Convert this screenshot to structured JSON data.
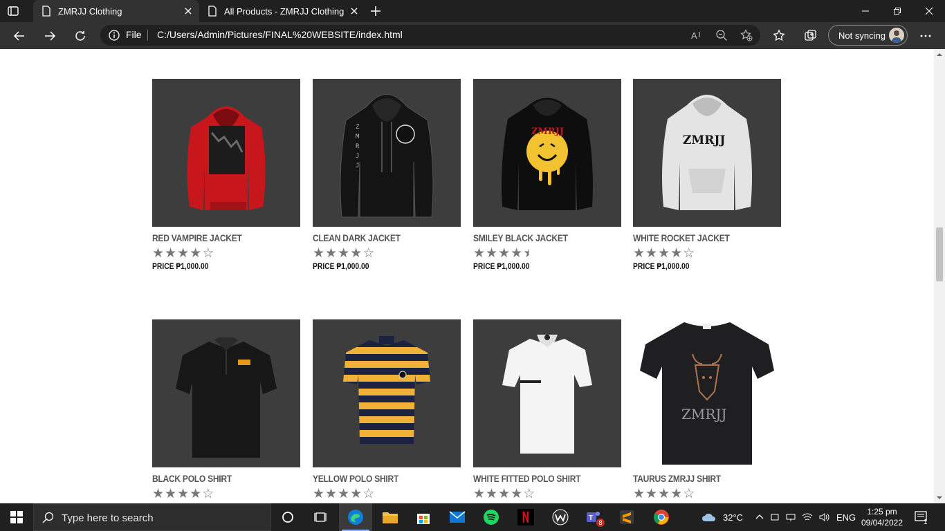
{
  "browser": {
    "tabs": [
      {
        "title": "ZMRJJ Clothing",
        "active": true
      },
      {
        "title": "All Products - ZMRJJ Clothing",
        "active": false
      }
    ],
    "address": {
      "scheme_label": "File",
      "url": "C:/Users/Admin/Pictures/FINAL%20WEBSITE/index.html"
    },
    "sync_label": "Not syncing"
  },
  "products": [
    {
      "name": "RED VAMPIRE JACKET",
      "price": "PRICE ₱1,000.00",
      "rating": 4,
      "image": "red-hoodie"
    },
    {
      "name": "CLEAN DARK JACKET",
      "price": "PRICE ₱1,000.00",
      "rating": 4,
      "image": "black-hoodie"
    },
    {
      "name": "SMILEY BLACK JACKET",
      "price": "PRICE ₱1,000.00",
      "rating": 4.5,
      "image": "smiley-hoodie"
    },
    {
      "name": "WHITE ROCKET JACKET",
      "price": "PRICE ₱1,000.00",
      "rating": 4,
      "image": "white-hoodie"
    },
    {
      "name": "BLACK POLO SHIRT",
      "price": "",
      "rating": 4,
      "image": "black-polo"
    },
    {
      "name": "YELLOW POLO SHIRT",
      "price": "",
      "rating": 4,
      "image": "yellow-polo"
    },
    {
      "name": "WHITE FITTED POLO SHIRT",
      "price": "",
      "rating": 4,
      "image": "white-polo"
    },
    {
      "name": "TAURUS ZMRJJ SHIRT",
      "price": "",
      "rating": 4,
      "image": "taurus-shirt"
    }
  ],
  "taskbar": {
    "search_placeholder": "Type here to search",
    "weather": "32°C",
    "language": "ENG",
    "time": "1:25 pm",
    "date": "09/04/2022",
    "teams_badge": "8",
    "notification_count": "1",
    "apps": [
      "task-view",
      "edge",
      "file-explorer",
      "microsoft-store",
      "mail",
      "spotify",
      "netflix",
      "wps",
      "teams",
      "sublime-text",
      "chrome"
    ]
  },
  "colors": {
    "chrome_dark": "#202020",
    "chrome_toolbar": "#323232",
    "product_tile": "#3d3d3d",
    "star": "#777777"
  }
}
